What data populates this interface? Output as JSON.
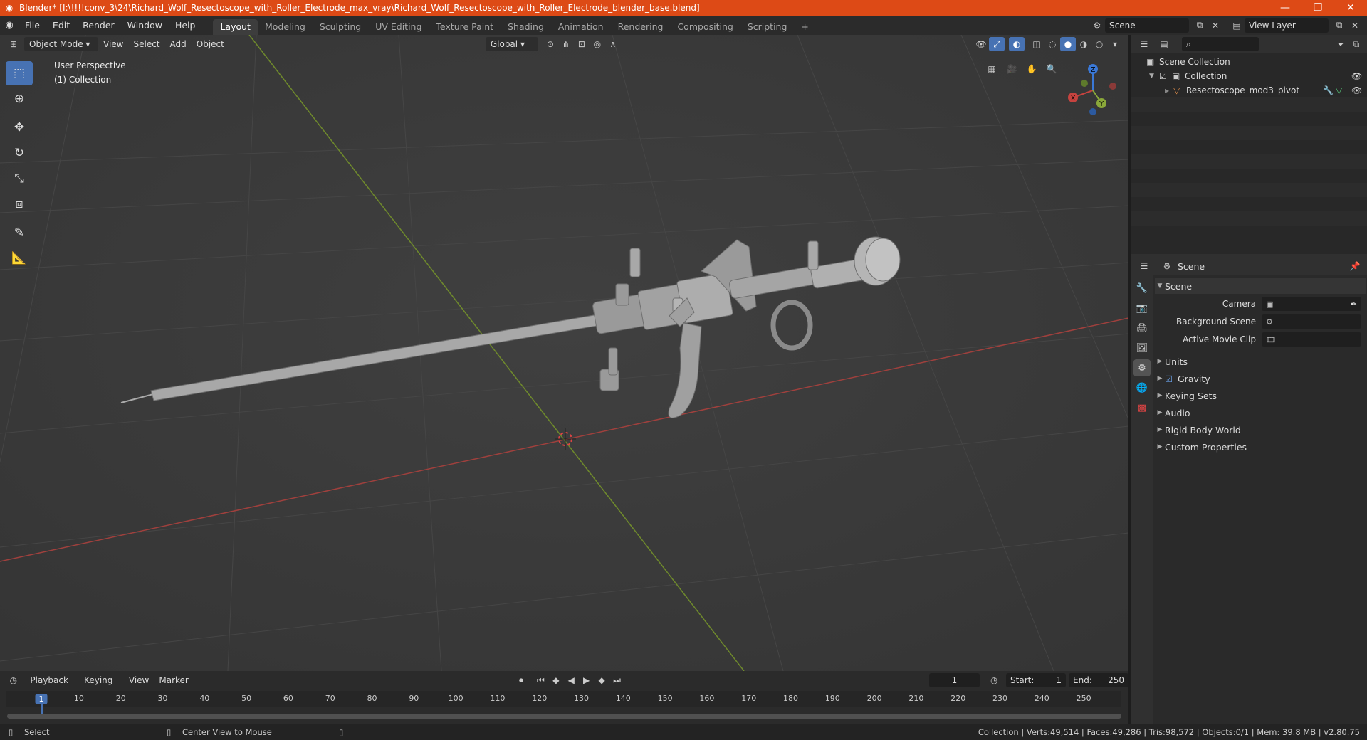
{
  "window": {
    "title": "Blender* [I:\\!!!!conv_3\\24\\Richard_Wolf_Resectoscope_with_Roller_Electrode_max_vray\\Richard_Wolf_Resectoscope_with_Roller_Electrode_blender_base.blend]",
    "minimize": "—",
    "maximize": "❐",
    "close": "✕"
  },
  "menu": [
    "File",
    "Edit",
    "Render",
    "Window",
    "Help"
  ],
  "workspaces": [
    "Layout",
    "Modeling",
    "Sculpting",
    "UV Editing",
    "Texture Paint",
    "Shading",
    "Animation",
    "Rendering",
    "Compositing",
    "Scripting"
  ],
  "add_workspace": "+",
  "scene_selector": "Scene",
  "view_layer_selector": "View Layer",
  "viewport": {
    "mode": "Object Mode",
    "menus": [
      "View",
      "Select",
      "Add",
      "Object"
    ],
    "orientation": "Global",
    "overlay_title": "User Perspective",
    "overlay_collection": "(1) Collection",
    "gizmo": {
      "x": "X",
      "y": "Y",
      "z": "Z"
    }
  },
  "outliner": {
    "root": "Scene Collection",
    "collection": "Collection",
    "object": "Resectoscope_mod3_pivot"
  },
  "properties": {
    "header": "Scene",
    "panel_title": "Scene",
    "fields": [
      {
        "label": "Camera"
      },
      {
        "label": "Background Scene"
      },
      {
        "label": "Active Movie Clip"
      }
    ],
    "sections": [
      "Units",
      "Gravity",
      "Keying Sets",
      "Audio",
      "Rigid Body World",
      "Custom Properties"
    ]
  },
  "timeline": {
    "menus": [
      "Playback",
      "Keying",
      "View",
      "Marker"
    ],
    "current_frame": "1",
    "start_label": "Start:",
    "start": "1",
    "end_label": "End:",
    "end": "250",
    "ticks": [
      "1",
      "10",
      "20",
      "30",
      "40",
      "50",
      "60",
      "70",
      "80",
      "90",
      "100",
      "110",
      "120",
      "130",
      "140",
      "150",
      "160",
      "170",
      "180",
      "190",
      "200",
      "210",
      "220",
      "230",
      "240",
      "250"
    ]
  },
  "status": {
    "select": "Select",
    "center_view": "Center View to Mouse",
    "stats": "Collection | Verts:49,514 | Faces:49,286 | Tris:98,572 | Objects:0/1 | Mem: 39.8 MB | v2.80.75"
  },
  "colors": {
    "title_bar": "#dd4a16",
    "accent": "#4772b3",
    "x_axis": "#c6433f",
    "y_axis": "#8aa83a",
    "z_axis": "#3a78d6"
  }
}
